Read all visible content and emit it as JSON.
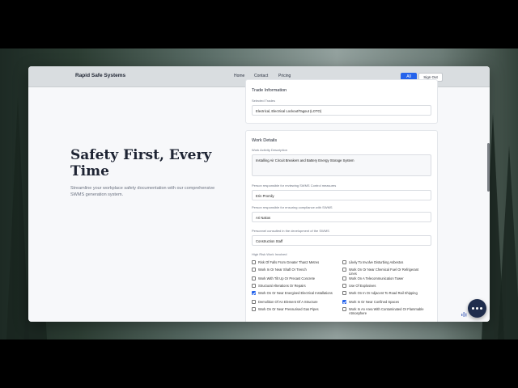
{
  "nav": {
    "brand": "Rapid Safe Systems",
    "links": [
      "Home",
      "Contact",
      "Pricing"
    ],
    "all_button": "All",
    "signout_button": "Sign Out"
  },
  "hero": {
    "title": "Safety First, Every Time",
    "subtitle": "Streamline your workplace safety documentation with our comprehensive SWMS generation system."
  },
  "trade": {
    "title": "Trade Information",
    "selected_label": "Selected Trades",
    "selected_value": "Electrical, Electrical Lockout/Tagout (LOTO)"
  },
  "work": {
    "title": "Work Details",
    "activity_label": "Work Activity Description",
    "activity_value": "Installing Air Circuit Breakers and Battery Energy Storage System",
    "reviewer_label": "Person responsible for reviewing SWMS Control measures",
    "reviewer_value": "Erin Promily",
    "compliance_label": "Person responsible for ensuring compliance with SWMS",
    "compliance_value": "Ari Nakos",
    "consulted_label": "Personnel consulted in the development of the SWMS",
    "consulted_value": "Construction Staff",
    "high_risk_label": "High Risk Work Involved",
    "high_risk_items": [
      {
        "label": "Risk Of Falls From Greater Than2 Metres",
        "checked": false
      },
      {
        "label": "Likely To Involve Disturbing Asbestos",
        "checked": false
      },
      {
        "label": "Work In Or Near Shaft Or Trench",
        "checked": false
      },
      {
        "label": "Work On Or Near Chemical Fuel Or Refrigerant Lines",
        "checked": false
      },
      {
        "label": "Work With Tilt Up Or Precast Concrete",
        "checked": false
      },
      {
        "label": "Work On A Telecommunication Tower",
        "checked": false
      },
      {
        "label": "Structural Alterations Or Repairs",
        "checked": false
      },
      {
        "label": "Use Of Explosives",
        "checked": false
      },
      {
        "label": "Work On Or Near Energised Electrical Installations",
        "checked": true
      },
      {
        "label": "Work On In Or Adjacent To Road Rail Shipping",
        "checked": false
      },
      {
        "label": "Demolition Of An Element Of A Structure",
        "checked": false
      },
      {
        "label": "Work In Or Near Confined Spaces",
        "checked": true
      },
      {
        "label": "Work On Or Near Pressurised Gas Pipes",
        "checked": false
      },
      {
        "label": "Work In An Area With Contaminated Or Flammable Atmosphere",
        "checked": false
      }
    ]
  },
  "icons": {
    "chat": "chat-bubble-icon",
    "audio": "audio-levels-icon"
  },
  "colors": {
    "accent": "#2563eb",
    "chat": "#1f2d4d",
    "navbar": "#d9dde0"
  }
}
